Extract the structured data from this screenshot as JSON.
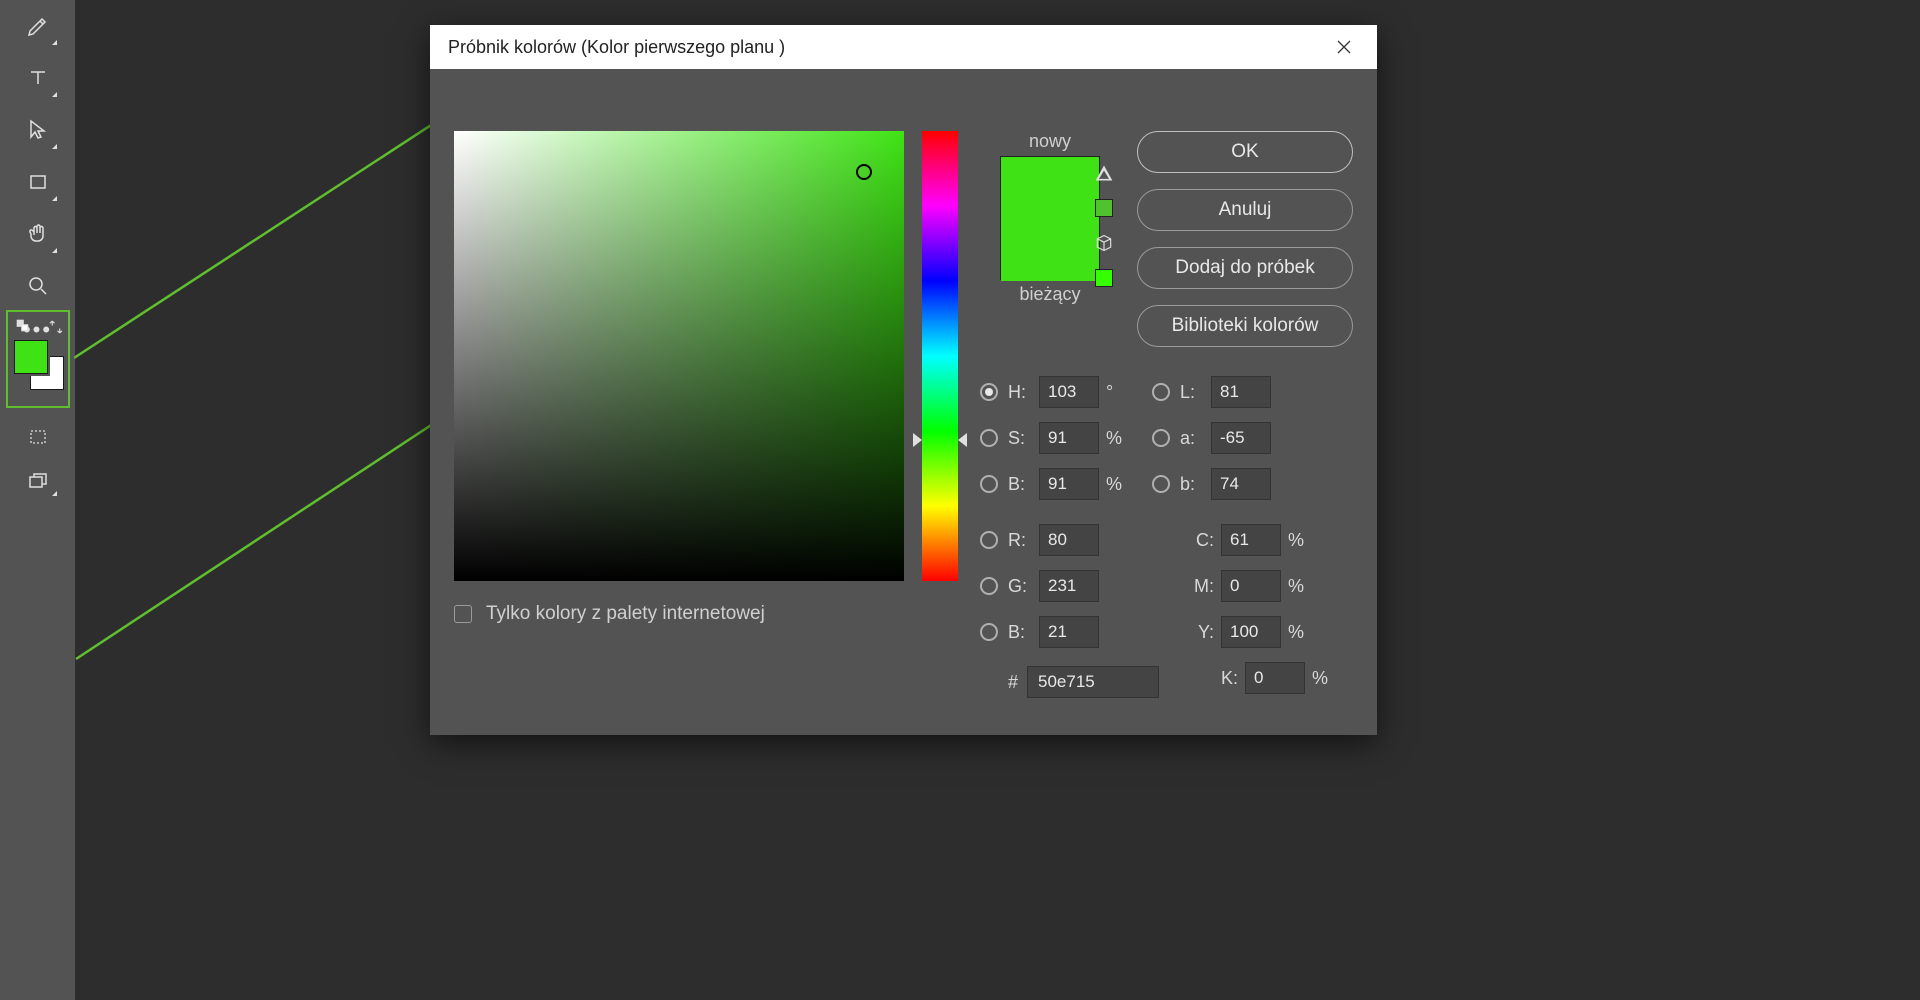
{
  "dialog": {
    "title": "Próbnik kolorów (Kolor pierwszego planu )",
    "buttons": {
      "ok": "OK",
      "cancel": "Anuluj",
      "add": "Dodaj do próbek",
      "libs": "Biblioteki kolorów"
    },
    "swatch": {
      "new_label": "nowy",
      "current_label": "bieżący",
      "new_color": "#3fe315",
      "current_color": "#3fe315"
    },
    "webonly_label": "Tylko kolory z palety internetowej",
    "fields": {
      "H": {
        "label": "H:",
        "value": "103",
        "unit": "°"
      },
      "S": {
        "label": "S:",
        "value": "91",
        "unit": "%"
      },
      "Bv": {
        "label": "B:",
        "value": "91",
        "unit": "%"
      },
      "R": {
        "label": "R:",
        "value": "80",
        "unit": ""
      },
      "G": {
        "label": "G:",
        "value": "231",
        "unit": ""
      },
      "B": {
        "label": "B:",
        "value": "21",
        "unit": ""
      },
      "L": {
        "label": "L:",
        "value": "81",
        "unit": ""
      },
      "a": {
        "label": "a:",
        "value": "-65",
        "unit": ""
      },
      "b": {
        "label": "b:",
        "value": "74",
        "unit": ""
      },
      "C": {
        "label": "C:",
        "value": "61",
        "unit": "%"
      },
      "M": {
        "label": "M:",
        "value": "0",
        "unit": "%"
      },
      "Y": {
        "label": "Y:",
        "value": "100",
        "unit": "%"
      },
      "K": {
        "label": "K:",
        "value": "0",
        "unit": "%"
      },
      "hex": {
        "label": "#",
        "value": "50e715"
      }
    }
  }
}
